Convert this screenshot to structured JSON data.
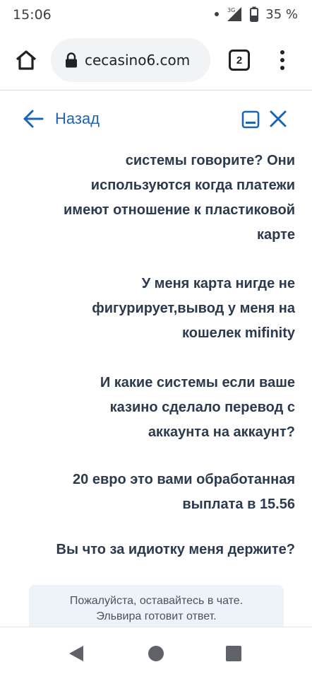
{
  "status_bar": {
    "time": "15:06",
    "signal_label": "3G",
    "battery": "35 %"
  },
  "browser": {
    "url": "cecasino6.com",
    "tab_count": "2",
    "icons": [
      "home-icon",
      "lock-icon",
      "tab-switcher-icon",
      "more-vert-icon"
    ]
  },
  "chat_header": {
    "back_label": "Назад",
    "accent_color": "#1e64b4",
    "icons": [
      "arrow-left-icon",
      "minimize-icon",
      "close-icon"
    ]
  },
  "messages": [
    {
      "lines": [
        "системы говорите? Они",
        "используются когда платежи",
        "имеют отношение к пластиковой",
        "карте"
      ]
    },
    {
      "lines": [
        "У меня карта нигде не",
        "фигурирует,вывод у меня на",
        "кошелек mifinity"
      ]
    },
    {
      "lines": [
        "И какие системы если ваше",
        "казино сделало перевод с",
        "аккаунта на аккаунт?"
      ]
    },
    {
      "lines": [
        "20 евро это вами обработанная",
        "выплата в 15.56"
      ]
    },
    {
      "lines": [
        "Вы что за идиотку меня держите?"
      ]
    }
  ],
  "notice": {
    "line1": "Пожалуйста, оставайтесь в чате.",
    "line2": "Эльвира готовит ответ."
  },
  "nav_bar": {
    "icons": [
      "back-triangle-icon",
      "home-circle-icon",
      "recents-square-icon"
    ]
  }
}
